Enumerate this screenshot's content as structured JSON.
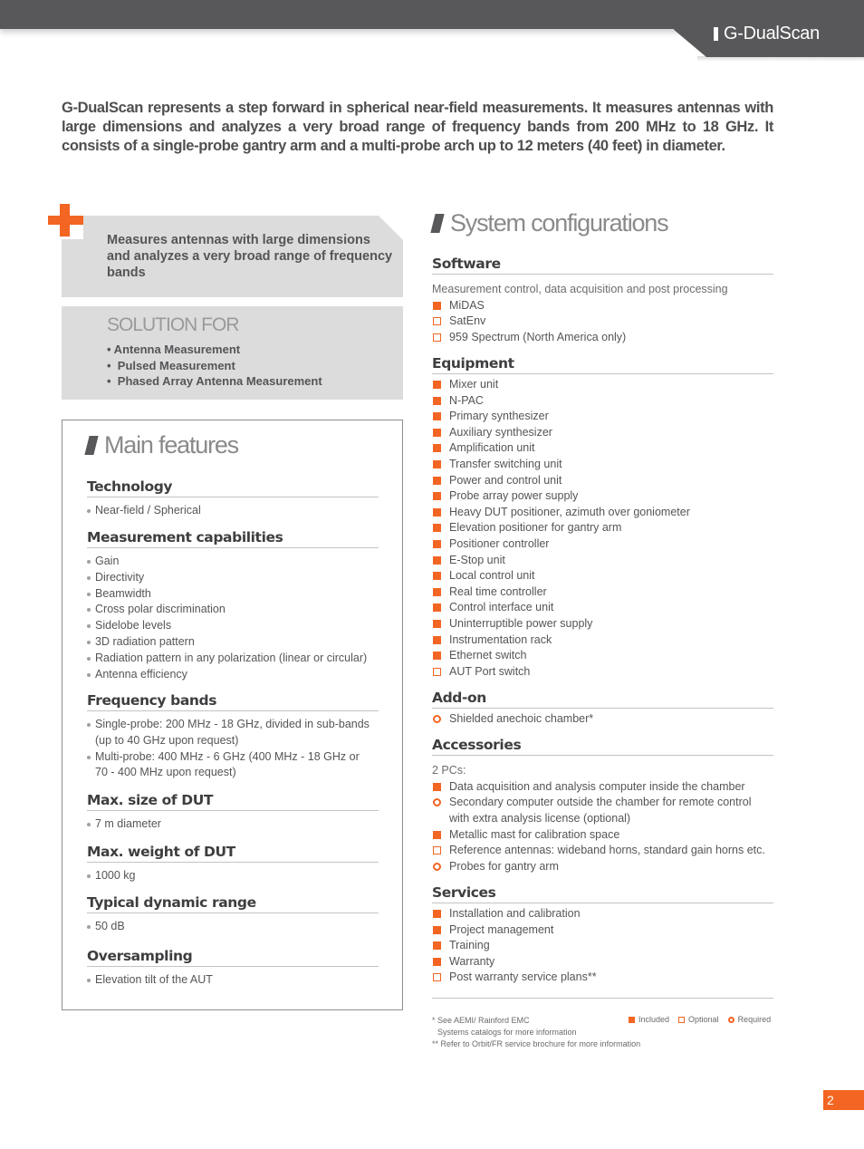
{
  "header": {
    "product_name": "G-DualScan"
  },
  "intro": "G-DualScan represents a step forward in spherical near-field measurements. It measures antennas with large dimensions and analyzes a very broad range of frequency bands from 200 MHz to 18 GHz. It consists of a single-probe gantry arm and a multi-probe arch up to 12 meters (40 feet) in diameter.",
  "highlight": {
    "icon": "plus-icon",
    "text": "Measures antennas with large dimensions and analyzes a very broad range of frequency bands"
  },
  "solution_for": {
    "title": "SOLUTION FOR",
    "items": [
      "• Antenna Measurement",
      "•  Pulsed Measurement",
      "•  Phased Array Antenna Measurement"
    ]
  },
  "main_features": {
    "title": "Main features",
    "groups": [
      {
        "heading": "Technology",
        "items": [
          "Near-field / Spherical"
        ]
      },
      {
        "heading": "Measurement capabilities",
        "items": [
          "Gain",
          "Directivity",
          "Beamwidth",
          "Cross polar discrimination",
          "Sidelobe levels",
          "3D radiation pattern",
          "Radiation pattern in any polarization (linear or circular)",
          "Antenna efficiency"
        ]
      },
      {
        "heading": "Frequency bands",
        "items": [
          "Single-probe: 200 MHz - 18 GHz, divided in sub-bands (up to 40 GHz upon request)",
          "Multi-probe: 400 MHz - 6 GHz (400 MHz - 18 GHz or 70 - 400 MHz upon request)"
        ]
      },
      {
        "heading": "Max. size of DUT",
        "items": [
          "7 m diameter"
        ]
      },
      {
        "heading": "Max. weight of DUT",
        "items": [
          "1000 kg"
        ]
      },
      {
        "heading": "Typical dynamic range",
        "items": [
          "50 dB"
        ]
      },
      {
        "heading": "Oversampling",
        "items": [
          "Elevation tilt of the AUT"
        ]
      }
    ]
  },
  "system_configurations": {
    "title": "System configurations",
    "groups": [
      {
        "heading": "Software",
        "description": "Measurement control, data acquisition and post processing",
        "items": [
          {
            "label": "MiDAS",
            "status": "included"
          },
          {
            "label": "SatEnv",
            "status": "optional"
          },
          {
            "label": "959 Spectrum (North America only)",
            "status": "optional"
          }
        ]
      },
      {
        "heading": "Equipment",
        "items": [
          {
            "label": "Mixer unit",
            "status": "included"
          },
          {
            "label": "N-PAC",
            "status": "included"
          },
          {
            "label": "Primary synthesizer",
            "status": "included"
          },
          {
            "label": "Auxiliary synthesizer",
            "status": "included"
          },
          {
            "label": "Amplification unit",
            "status": "included"
          },
          {
            "label": "Transfer switching unit",
            "status": "included"
          },
          {
            "label": "Power and control unit",
            "status": "included"
          },
          {
            "label": "Probe array power supply",
            "status": "included"
          },
          {
            "label": "Heavy DUT positioner, azimuth over goniometer",
            "status": "included"
          },
          {
            "label": "Elevation positioner for gantry arm",
            "status": "included"
          },
          {
            "label": "Positioner controller",
            "status": "included"
          },
          {
            "label": "E-Stop unit",
            "status": "included"
          },
          {
            "label": "Local control unit",
            "status": "included"
          },
          {
            "label": "Real time controller",
            "status": "included"
          },
          {
            "label": "Control interface unit",
            "status": "included"
          },
          {
            "label": "Uninterruptible power supply",
            "status": "included"
          },
          {
            "label": "Instrumentation rack",
            "status": "included"
          },
          {
            "label": "Ethernet switch",
            "status": "included"
          },
          {
            "label": "AUT Port switch",
            "status": "optional"
          }
        ]
      },
      {
        "heading": "Add-on",
        "items": [
          {
            "label": "Shielded anechoic chamber*",
            "status": "required"
          }
        ]
      },
      {
        "heading": "Accessories",
        "description": "2 PCs:",
        "items": [
          {
            "label": "Data acquisition and analysis computer inside the chamber",
            "status": "included"
          },
          {
            "label": "Secondary computer outside the chamber for remote control with extra analysis license (optional)",
            "status": "required"
          },
          {
            "label": "Metallic mast for calibration space",
            "status": "included"
          },
          {
            "label": "Reference antennas: wideband horns, standard gain horns etc.",
            "status": "optional"
          },
          {
            "label": "Probes for gantry arm",
            "status": "required"
          }
        ]
      },
      {
        "heading": "Services",
        "items": [
          {
            "label": "Installation and calibration",
            "status": "included"
          },
          {
            "label": "Project management",
            "status": "included"
          },
          {
            "label": "Training",
            "status": "included"
          },
          {
            "label": "Warranty",
            "status": "included"
          },
          {
            "label": "Post warranty service plans**",
            "status": "optional"
          }
        ]
      }
    ]
  },
  "footnotes": {
    "note1_line1": "* See AEMI/ Rainford EMC",
    "note1_line2": "Systems catalogs for more information",
    "note2": "** Refer to Orbit/FR service brochure for more information"
  },
  "legend": {
    "included": "Included",
    "optional": "Optional",
    "required": "Required"
  },
  "colors": {
    "accent": "#f26522",
    "header": "#58585a",
    "panel": "#dcdcdd"
  },
  "page_number": "2"
}
